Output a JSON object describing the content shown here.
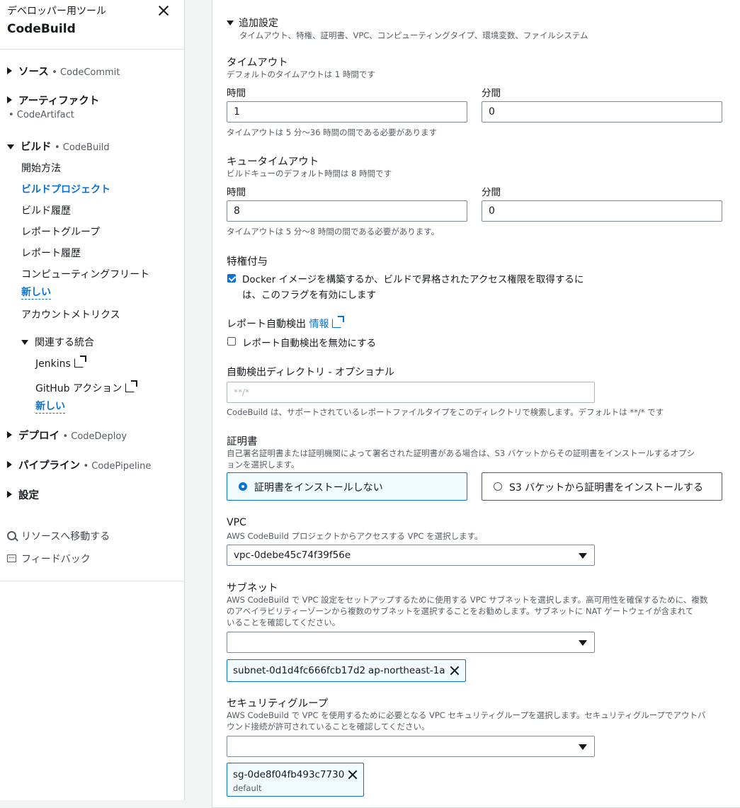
{
  "sidebar": {
    "subtitle": "デベロッパー用ツール",
    "title": "CodeBuild",
    "source": {
      "label": "ソース",
      "service": "• CodeCommit"
    },
    "artifact": {
      "label": "アーティファクト",
      "service": "• CodeArtifact"
    },
    "build": {
      "label": "ビルド",
      "service": "• CodeBuild",
      "items": [
        "開始方法",
        "ビルドプロジェクト",
        "ビルド履歴",
        "レポートグループ",
        "レポート履歴",
        "コンピューティングフリート",
        "アカウントメトリクス"
      ],
      "new_badge": "新しい"
    },
    "related": {
      "label": "関連する統合",
      "jenkins": "Jenkins",
      "github": "GitHub アクション",
      "new_badge": "新しい"
    },
    "deploy": {
      "label": "デプロイ",
      "service": "• CodeDeploy"
    },
    "pipeline": {
      "label": "パイプライン",
      "service": "• CodePipeline"
    },
    "settings": {
      "label": "設定"
    },
    "goto_resource": "リソースへ移動する",
    "feedback": "フィードバック"
  },
  "main": {
    "additional": {
      "title": "追加設定",
      "desc": "タイムアウト、特権、証明書、VPC、コンピューティングタイプ、環境変数、ファイルシステム"
    },
    "timeout": {
      "title": "タイムアウト",
      "desc": "デフォルトのタイムアウトは 1 時間です",
      "hours_label": "時間",
      "hours_value": "1",
      "minutes_label": "分間",
      "minutes_value": "0",
      "hint": "タイムアウトは 5 分〜36 時間の間である必要があります"
    },
    "queue_timeout": {
      "title": "キュータイムアウト",
      "desc": "ビルドキューのデフォルト時間は 8 時間です",
      "hours_label": "時間",
      "hours_value": "8",
      "minutes_label": "分間",
      "minutes_value": "0",
      "hint": "タイムアウトは 5 分〜8 時間の間である必要があります。"
    },
    "privileged": {
      "title": "特権付与",
      "line1": "Docker イメージを構築するか、ビルドで昇格されたアクセス権限を取得するに",
      "line2": "は、このフラグを有効にします"
    },
    "report_autodetect": {
      "title": "レポート自動検出",
      "info": "情報",
      "checkbox": "レポート自動検出を無効にする"
    },
    "autodetect_dir": {
      "title": "自動検出ディレクトリ - オプショナル",
      "placeholder": "**/*",
      "hint": "CodeBuild は、サポートされているレポートファイルタイプをこのディレクトリで検索します。デフォルトは **/* です"
    },
    "certificate": {
      "title": "証明書",
      "desc1": "自己署名証明書または証明機関によって署名された証明書がある場合は、S3 バケットからその証明書をインストールするオプシ",
      "desc2": "ョンを選択します。",
      "opt1": "証明書をインストールしない",
      "opt2": "S3 バケットから証明書をインストールする"
    },
    "vpc": {
      "title": "VPC",
      "desc": "AWS CodeBuild プロジェクトからアクセスする VPC を選択します。",
      "value": "vpc-0debe45c74f39f56e"
    },
    "subnet": {
      "title": "サブネット",
      "desc1": "AWS CodeBuild で VPC 設定をセットアップするために使用する VPC サブネットを選択します。高可用性を確保するために、複数",
      "desc2": "のアベイラビリティーゾーンから複数のサブネットを選択することをお勧めします。サブネットに NAT ゲートウェイが含まれて",
      "desc3": "いることを確認してください。",
      "token_id": "subnet-0d1d4fc666fcb17d2",
      "token_az": "ap-northeast-1a"
    },
    "security_group": {
      "title": "セキュリティグループ",
      "desc1": "AWS CodeBuild で VPC を使用するために必要となる VPC セキュリティグループを選択します。セキュリティグループでアウトバ",
      "desc2": "ウンド接続が許可されていることを確認してください。",
      "token_id": "sg-0de8f04fb493c7730",
      "token_sub": "default"
    }
  }
}
